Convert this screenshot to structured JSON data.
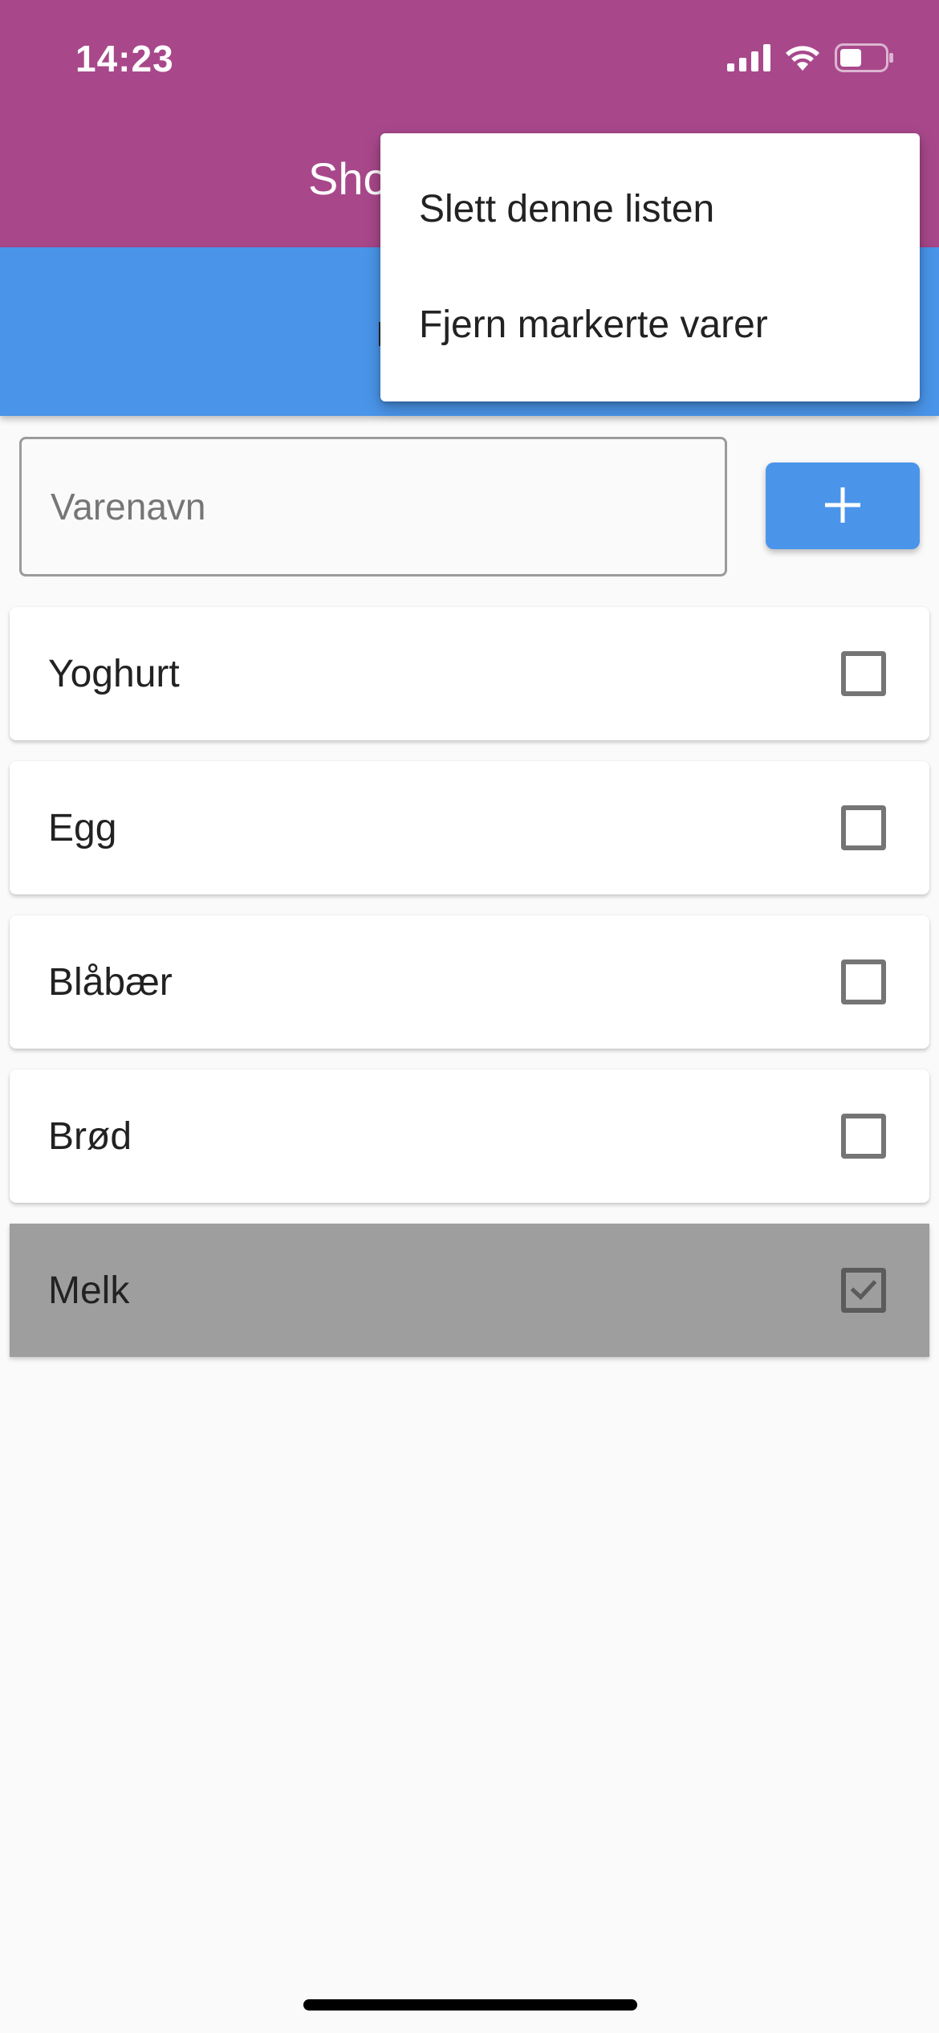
{
  "status_bar": {
    "time": "14:23",
    "icons": [
      "signal-icon",
      "wifi-icon",
      "battery-icon"
    ]
  },
  "app_bar": {
    "title": "Sho",
    "color": "#a8488b"
  },
  "sub_bar": {
    "label": "I",
    "color": "#4a95ea"
  },
  "menu": {
    "items": [
      {
        "label": "Slett denne listen"
      },
      {
        "label": "Fjern markerte varer"
      }
    ]
  },
  "input": {
    "placeholder": "Varenavn",
    "value": ""
  },
  "add_button": {
    "icon": "plus-icon"
  },
  "items": [
    {
      "label": "Yoghurt",
      "checked": false
    },
    {
      "label": "Egg",
      "checked": false
    },
    {
      "label": "Blåbær",
      "checked": false
    },
    {
      "label": "Brød",
      "checked": false
    },
    {
      "label": "Melk",
      "checked": true
    }
  ]
}
